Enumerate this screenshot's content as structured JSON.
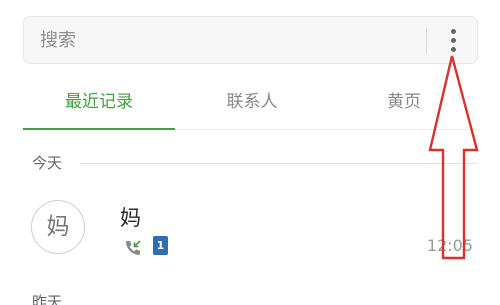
{
  "search": {
    "placeholder": "搜索",
    "menu_icon": "more-vert-icon"
  },
  "tabs": [
    {
      "label": "最近记录",
      "active": true
    },
    {
      "label": "联系人",
      "active": false
    },
    {
      "label": "黄页",
      "active": false
    }
  ],
  "sections": {
    "today": "今天",
    "next_partial": "昨天"
  },
  "calls": [
    {
      "avatar_char": "妈",
      "name": "妈",
      "type_icon": "incoming-call-icon",
      "sim_slot": "1",
      "time": "12:05"
    }
  ],
  "colors": {
    "accent": "#3fa33f",
    "annotation": "#d9312b",
    "sim_badge": "#2f6db2"
  }
}
